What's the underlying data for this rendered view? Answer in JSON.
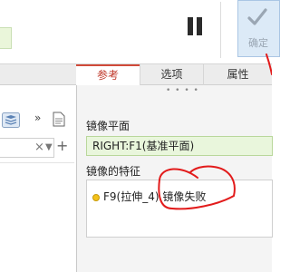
{
  "ribbon": {
    "pause_icon": "pause-icon",
    "ok_label": "确定",
    "ok_icon": "check-icon"
  },
  "tabs": [
    {
      "label": "参考",
      "active": true
    },
    {
      "label": "选项",
      "active": false
    },
    {
      "label": "属性",
      "active": false
    }
  ],
  "left_panel": {
    "icons": [
      "layers-icon",
      "double-chevron-right-icon",
      "document-icon"
    ],
    "filter": {
      "value": "",
      "clear_icon": "×",
      "dropdown_icon": "▼",
      "add_icon": "+"
    }
  },
  "panel": {
    "mirror_plane_label": "镜像平面",
    "mirror_plane_value": "RIGHT:F1(基准平面)",
    "mirrored_features_label": "镜像的特征",
    "features": [
      {
        "text": "F9(拉伸_4) 镜像失败",
        "status": "warning"
      }
    ]
  },
  "colors": {
    "active_tab": "#c0392b",
    "plane_field_bg": "#e9f6dc",
    "warning": "#f4c21a",
    "annotation": "#e21b1b"
  }
}
